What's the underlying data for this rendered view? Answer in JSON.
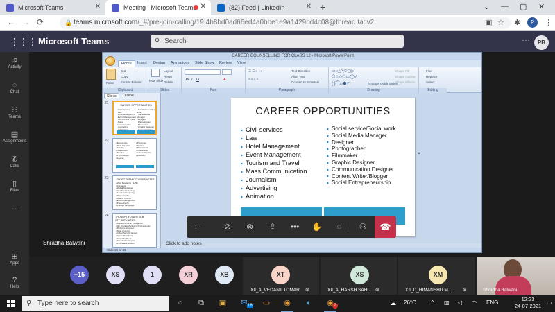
{
  "browser": {
    "tabs": [
      {
        "label": "Microsoft Teams",
        "favicon_color": "#5059c9"
      },
      {
        "label": "Meeting | Microsoft Teams",
        "favicon_color": "#5059c9"
      },
      {
        "label": "(82) Feed | LinkedIn",
        "favicon_color": "#0a66c2"
      }
    ],
    "url_host": "teams.microsoft.com",
    "url_path": "/_#/pre-join-calling/19:4b8bd0ad66ed4a0bbe1e9a1429bd4c08@thread.tacv2",
    "profile_initial": "P"
  },
  "teams": {
    "app_title": "Microsoft Teams",
    "search_placeholder": "Search",
    "user_initials": "PB",
    "rail": [
      {
        "label": "Activity",
        "icon": "bell-icon"
      },
      {
        "label": "Chat",
        "icon": "chat-icon"
      },
      {
        "label": "Teams",
        "icon": "teams-icon"
      },
      {
        "label": "Assignments",
        "icon": "assignments-icon"
      },
      {
        "label": "Calls",
        "icon": "phone-icon"
      },
      {
        "label": "Files",
        "icon": "files-icon"
      },
      {
        "label": "...",
        "icon": "more-icon"
      },
      {
        "label": "Apps",
        "icon": "apps-icon"
      },
      {
        "label": "Help",
        "icon": "help-icon"
      }
    ],
    "presenter_name": "Shradha Balwani"
  },
  "powerpoint": {
    "window_title": "CAREER COUNSELLING FOR CLASS 12 - Microsoft PowerPoint",
    "tabs": [
      "Home",
      "Insert",
      "Design",
      "Animations",
      "Slide Show",
      "Review",
      "View"
    ],
    "ribbon": {
      "clipboard": {
        "label": "Clipboard",
        "paste": "Paste",
        "cut": "Cut",
        "copy": "Copy",
        "format_painter": "Format Painter"
      },
      "slides": {
        "label": "Slides",
        "new_slide": "New Slide",
        "layout": "Layout",
        "reset": "Reset",
        "delete": "Delete"
      },
      "font": {
        "label": "Font"
      },
      "paragraph": {
        "label": "Paragraph",
        "text_direction": "Text Direction",
        "align_text": "Align Text",
        "convert": "Convert to SmartArt"
      },
      "drawing": {
        "label": "Drawing",
        "arrange": "Arrange",
        "quick_styles": "Quick Styles",
        "shape_fill": "Shape Fill",
        "shape_outline": "Shape Outline",
        "shape_effects": "Shape Effects"
      },
      "editing": {
        "label": "Editing",
        "find": "Find",
        "replace": "Replace",
        "select": "Select"
      }
    },
    "panel_tabs": [
      "Slides",
      "Outline"
    ],
    "thumbnails": [
      {
        "num": "21",
        "title": "CAREER OPPORTUNITIES",
        "left": [
          "Civil services",
          "Law",
          "Hotel Management",
          "Event Management",
          "Tourism and Travel",
          "Mass Communication",
          "Journalism",
          "Advertising",
          "Animation"
        ],
        "right": [
          "Social service/Social work",
          "Social Media Manager",
          "Designer",
          "Photographer",
          "Filmmaker",
          "Graphic Designer",
          "Communication Designer",
          "Content Writer/Blogger",
          "Social Entrepreneurship"
        ]
      },
      {
        "num": "22",
        "title": "",
        "left": [
          "Economics",
          "Data Scientist",
          "Actuary",
          "Statistician",
          "Teacher",
          "Psychologist",
          "Lawyer"
        ],
        "right": [
          "Physician",
          "Nursing",
          "Pharmacist",
          "Veterinarian",
          "Lab Technician",
          "Dietician"
        ]
      },
      {
        "num": "23",
        "title": "SHORT TERM COURSES AFTER 12th",
        "left": [
          "Web Designing",
          "Animation",
          "Digital Marketing",
          "Graphic Designing",
          "Fashion Designing",
          "Photography",
          "Beauty Course",
          "Event Management",
          "Photography",
          "Foreign Language"
        ],
        "right": []
      },
      {
        "num": "24",
        "title": "THOUGHT-FUTURE JOB OPPORTUNITIES",
        "left": [
          "Applied Artificial Intelligence",
          "3D - Digital Marketing Professionals",
          "Robotics Engineer",
          "Data scientist",
          "Cyber Security Expert",
          "Game Designers",
          "Cloud Architect",
          "Sustainable Expert",
          "Financial Planners"
        ],
        "right": []
      }
    ],
    "slide": {
      "title": "CAREER OPPORTUNITIES",
      "left": [
        "Civil services",
        "Law",
        "Hotel Management",
        "Event Management",
        "Tourism and Travel",
        "Mass Communication",
        "Journalism",
        "Advertising",
        "Animation"
      ],
      "right": [
        "Social service/Social work",
        "Social Media Manager",
        "Designer",
        "Photographer",
        "Filmmaker",
        "Graphic Designer",
        "Communication Designer",
        "Content Writer/Blogger",
        "Social Entrepreneurship"
      ]
    },
    "notes_placeholder": "Click to add notes",
    "status": "Slide 21 of 33"
  },
  "meeting_controls": {
    "timer": "--:--",
    "items": [
      "camera-off-icon",
      "mic-off-icon",
      "share-icon",
      "more-icon",
      "raise-hand-icon",
      "chat-icon",
      "participants-icon"
    ],
    "hangup_icon": "phone-hangup-icon"
  },
  "participants": {
    "bubbles": [
      {
        "label": "+15",
        "bg": "#5b5fc7",
        "fg": "#ffffff"
      },
      {
        "label": "XS",
        "bg": "#e0def5",
        "fg": "#333333"
      },
      {
        "label": "1",
        "bg": "#e0def5",
        "fg": "#333333"
      },
      {
        "label": "XR",
        "bg": "#f3d0d8",
        "fg": "#333333"
      },
      {
        "label": "XB",
        "bg": "#dfe8f5",
        "fg": "#333333"
      }
    ],
    "cards": [
      {
        "initials": "XT",
        "name": "XII_A_VEDANT TOMAR",
        "bg": "#f9d4c8"
      },
      {
        "initials": "XS",
        "name": "XII_A_HARSH SAHU",
        "bg": "#cfe8da"
      },
      {
        "initials": "XM",
        "name": "XII_D_HIMANSHU M...",
        "bg": "#f6e7b0"
      }
    ],
    "self_name": "Shradha Balwani"
  },
  "taskbar": {
    "search_placeholder": "Type here to search",
    "weather": "26°C",
    "language": "ENG",
    "time": "12:23",
    "date": "24-07-2021",
    "chrome_badge": "2",
    "outlook_badge": "18"
  }
}
